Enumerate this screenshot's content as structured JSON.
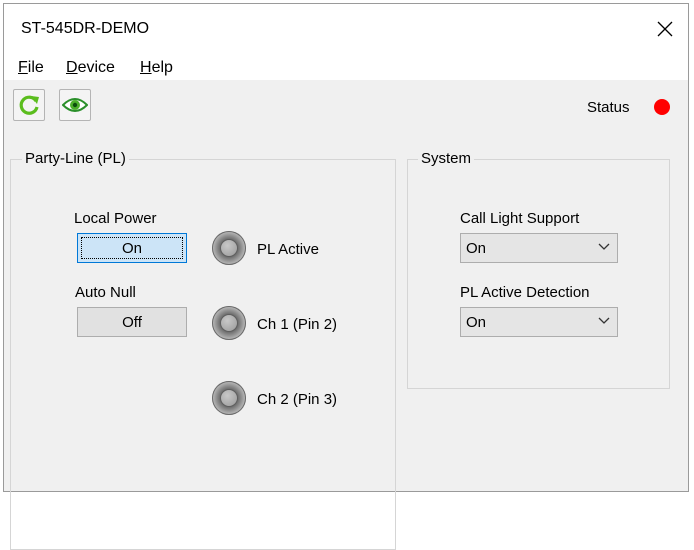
{
  "window": {
    "title": "ST-545DR-DEMO"
  },
  "menu": {
    "file": {
      "accel": "F",
      "rest": "ile"
    },
    "device": {
      "accel": "D",
      "rest": "evice"
    },
    "help": {
      "accel": "H",
      "rest": "elp"
    }
  },
  "toolbar": {
    "status_label": "Status",
    "status_color": "#ff0000"
  },
  "party_line": {
    "legend": "Party-Line (PL)",
    "local_power": {
      "label": "Local Power",
      "value": "On"
    },
    "auto_null": {
      "label": "Auto Null",
      "value": "Off"
    },
    "indicators": [
      "PL Active",
      "Ch 1 (Pin 2)",
      "Ch 2 (Pin 3)"
    ]
  },
  "system": {
    "legend": "System",
    "call_light": {
      "label": "Call Light Support",
      "value": "On"
    },
    "pl_detection": {
      "label": "PL Active Detection",
      "value": "On"
    }
  },
  "colors": {
    "refresh_icon": "#5bbd1e",
    "eye_icon": "#2a8f2a",
    "accent": "#0078d7"
  }
}
